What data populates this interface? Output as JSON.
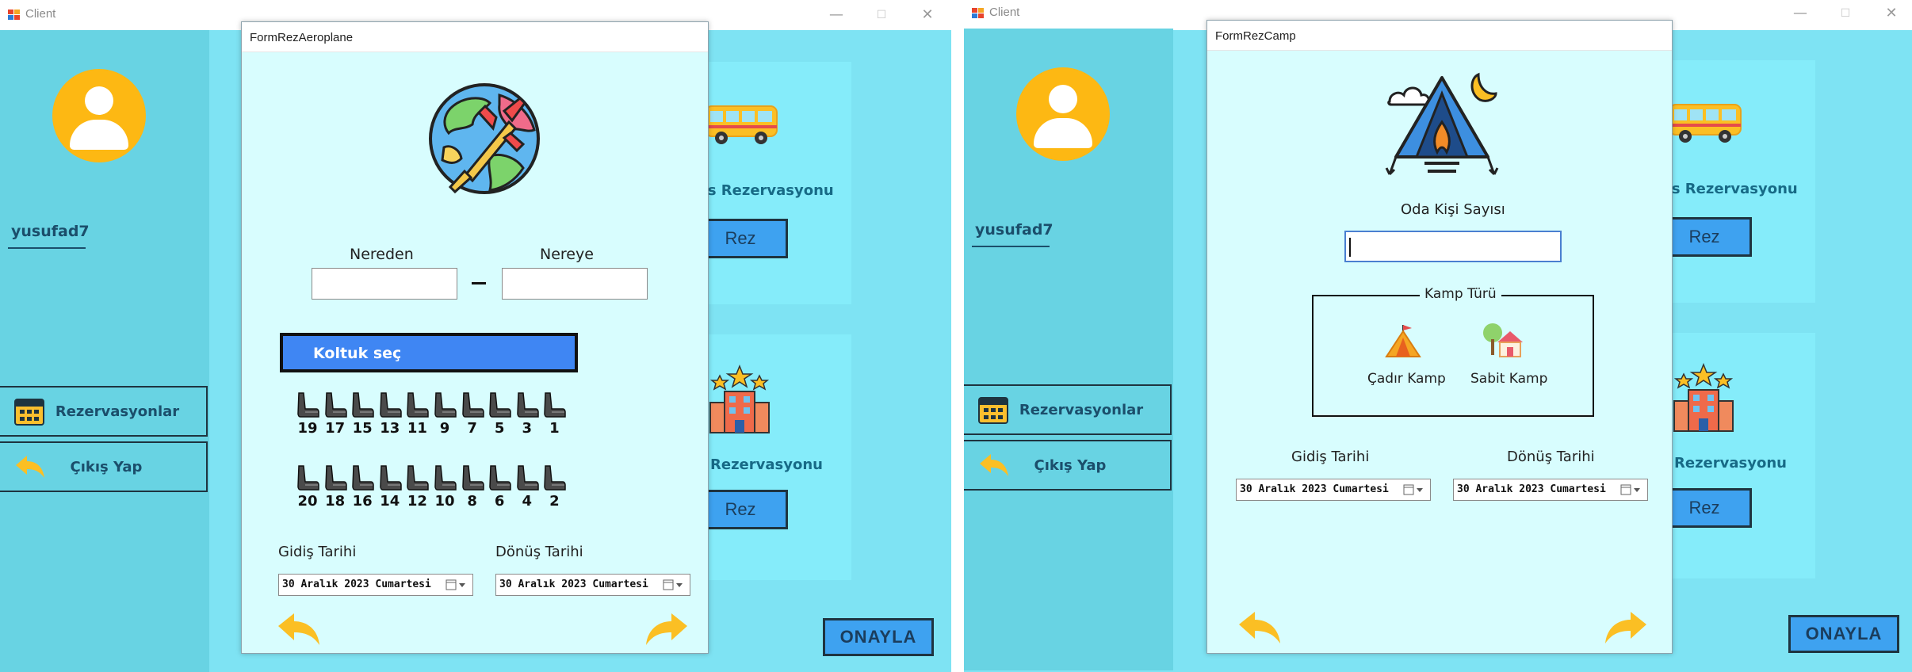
{
  "left_window": {
    "title": "Client",
    "username": "yusufad7",
    "sidebar": {
      "reservations_label": "Rezervasyonlar",
      "logout_label": "Çıkış Yap"
    },
    "cards": [
      {
        "title_fragment": "üs Rezervasyonu",
        "button_label": "Rez",
        "icon": "bus-icon"
      },
      {
        "title_fragment": "Rezervasyonu",
        "button_label": "Rez",
        "icon": "hotel-icon"
      }
    ],
    "confirm_label": "ONAYLA"
  },
  "right_window": {
    "title": "Client",
    "username": "yusufad7",
    "sidebar": {
      "reservations_label": "Rezervasyonlar",
      "logout_label": "Çıkış Yap"
    },
    "cards": [
      {
        "title_fragment": "üs Rezervasyonu",
        "button_label": "Rez",
        "icon": "bus-icon"
      },
      {
        "title_fragment": "Rezervasyonu",
        "button_label": "Rez",
        "icon": "hotel-icon"
      }
    ],
    "confirm_label": "ONAYLA"
  },
  "plane_form": {
    "title": "FormRezAeroplane",
    "from_label": "Nereden",
    "to_label": "Nereye",
    "from_value": "",
    "to_value": "",
    "seat_header": "Koltuk seç",
    "seats_top": [
      "19",
      "17",
      "15",
      "13",
      "11",
      "9",
      "7",
      "5",
      "3",
      "1"
    ],
    "seats_bottom": [
      "20",
      "18",
      "16",
      "14",
      "12",
      "10",
      "8",
      "6",
      "4",
      "2"
    ],
    "departure_label": "Gidiş Tarihi",
    "return_label": "Dönüş Tarihi",
    "departure_date": "30  Aralık  2023 Cumartesi",
    "return_date": "30  Aralık  2023 Cumartesi"
  },
  "camp_form": {
    "title": "FormRezCamp",
    "room_label": "Oda Kişi Sayısı",
    "room_value": "",
    "camp_type_label": "Kamp Türü",
    "tent_camp_label": "Çadır Kamp",
    "fixed_camp_label": "Sabit Kamp",
    "departure_label": "Gidiş Tarihi",
    "return_label": "Dönüş Tarihi",
    "departure_date": "30  Aralık  2023 Cumartesi",
    "return_date": "30  Aralık  2023 Cumartesi"
  },
  "colors": {
    "background": "#7ee3f3",
    "sidebar": "#68d3e3",
    "dialog": "#d8fdfe",
    "accent_blue": "#3ea2f0",
    "seat_header": "#3f86f3",
    "avatar_yellow": "#fdb813",
    "arrow_yellow": "#fbbf24"
  }
}
